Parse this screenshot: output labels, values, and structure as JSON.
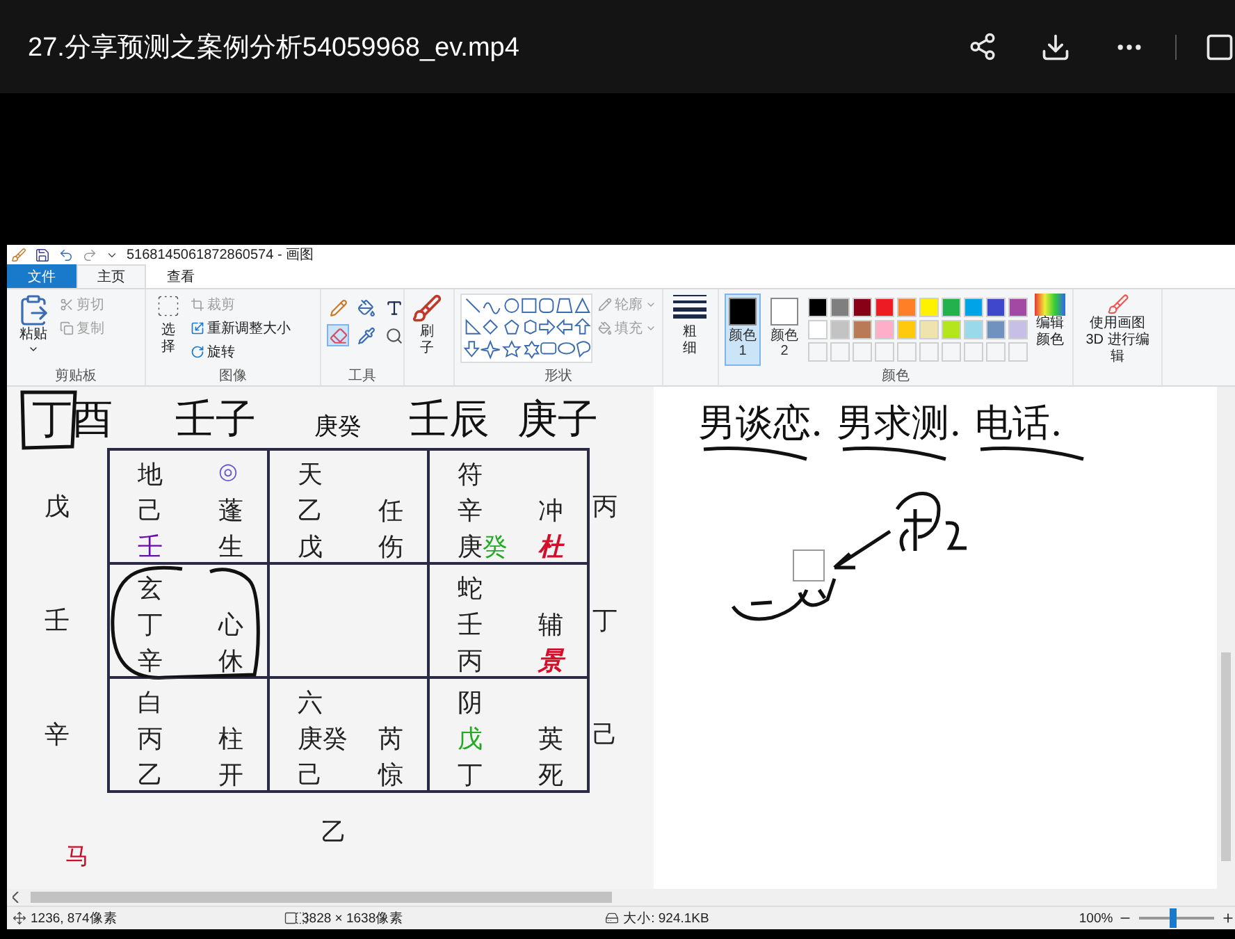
{
  "player": {
    "title": "27.分享预测之案例分析54059968_ev.mp4"
  },
  "paint": {
    "title": "5168145061872860574 - 画图",
    "tabs": [
      {
        "label": "文件",
        "kind": "file",
        "selected": false
      },
      {
        "label": "主页",
        "kind": "tab",
        "selected": true
      },
      {
        "label": "查看",
        "kind": "tab",
        "selected": false
      }
    ],
    "clipboard": {
      "paste": "粘贴",
      "items": [
        {
          "label": "剪切",
          "kind": "cut",
          "disabled": true
        },
        {
          "label": "复制",
          "kind": "copy",
          "disabled": true
        }
      ],
      "group": "剪贴板"
    },
    "image": {
      "select": "选择",
      "items": [
        {
          "label": "裁剪",
          "kind": "crop",
          "disabled": true
        },
        {
          "label": "重新调整大小",
          "kind": "resize",
          "disabled": false
        },
        {
          "label": "旋转",
          "kind": "rotate",
          "disabled": false
        }
      ],
      "group": "图像"
    },
    "tools": {
      "group": "工具"
    },
    "brushes": {
      "label": "刷子"
    },
    "shapes": {
      "group": "形状",
      "items": [
        {
          "label": "轮廓",
          "kind": "outline",
          "disabled": true
        },
        {
          "label": "填充",
          "kind": "fill",
          "disabled": true
        }
      ]
    },
    "size": {
      "label": "粗细"
    },
    "colors": {
      "group": "颜色",
      "slots": [
        {
          "label": "颜色 1",
          "color": "#000000",
          "selected": true
        },
        {
          "label": "颜色 2",
          "color": "#ffffff",
          "selected": false
        }
      ],
      "palette": [
        {
          "color": "#000000"
        },
        {
          "color": "#7f7f7f"
        },
        {
          "color": "#880015"
        },
        {
          "color": "#ed1c24"
        },
        {
          "color": "#ff7f27"
        },
        {
          "color": "#fff200"
        },
        {
          "color": "#22b14c"
        },
        {
          "color": "#00a2e8"
        },
        {
          "color": "#3f48cc"
        },
        {
          "color": "#a349a4"
        },
        {
          "color": "#ffffff"
        },
        {
          "color": "#c3c3c3"
        },
        {
          "color": "#b97a57"
        },
        {
          "color": "#ffaec9"
        },
        {
          "color": "#ffc90e"
        },
        {
          "color": "#efe4b0"
        },
        {
          "color": "#b5e61d"
        },
        {
          "color": "#99d9ea"
        },
        {
          "color": "#7092be"
        },
        {
          "color": "#c8bfe7"
        }
      ],
      "edit": "编辑颜色",
      "paint3d": "使用画图 3D 进行编辑"
    },
    "canvas": {
      "pillars": [
        {
          "text": "丁酉",
          "boxed": true
        },
        {
          "text": "壬子",
          "boxed": false
        },
        {
          "text": "庚癸",
          "kind": "printed",
          "boxed": false
        },
        {
          "text": "壬辰",
          "boxed": false
        },
        {
          "text": "庚子",
          "boxed": false
        }
      ],
      "left": [
        "戊",
        "壬",
        "辛"
      ],
      "right": [
        "丙",
        "丁",
        "己"
      ],
      "bottom": "乙",
      "horse": "马",
      "cells": [
        {
          "god": "地",
          "mark": "◎",
          "circled": false,
          "rows": [
            {
              "left": [
                {
                  "text": "己"
                }
              ],
              "right": {
                "text": "蓬"
              }
            },
            {
              "left": [
                {
                  "text": "壬",
                  "color": "#6a0dad"
                }
              ],
              "right": {
                "text": "生"
              }
            }
          ]
        },
        {
          "god": "天",
          "circled": false,
          "rows": [
            {
              "left": [
                {
                  "text": "乙"
                }
              ],
              "right": {
                "text": "任"
              }
            },
            {
              "left": [
                {
                  "text": "戊"
                }
              ],
              "right": {
                "text": "伤"
              }
            }
          ]
        },
        {
          "god": "符",
          "circled": false,
          "rows": [
            {
              "left": [
                {
                  "text": "辛"
                }
              ],
              "right": {
                "text": "冲"
              }
            },
            {
              "left": [
                {
                  "text": "庚"
                },
                {
                  "text": "癸",
                  "color": "#22aa22"
                }
              ],
              "right": {
                "text": "杜",
                "color": "#d0102a",
                "italic": true
              }
            }
          ]
        },
        {
          "god": "玄",
          "circled": true,
          "rows": [
            {
              "left": [
                {
                  "text": "丁"
                }
              ],
              "right": {
                "text": "心"
              }
            },
            {
              "left": [
                {
                  "text": "辛"
                }
              ],
              "right": {
                "text": "休"
              }
            }
          ]
        },
        {
          "circled": false
        },
        {
          "god": "蛇",
          "circled": false,
          "rows": [
            {
              "left": [
                {
                  "text": "壬"
                }
              ],
              "right": {
                "text": "辅"
              }
            },
            {
              "left": [
                {
                  "text": "丙"
                }
              ],
              "right": {
                "text": "景",
                "color": "#d0102a",
                "italic": true
              }
            }
          ]
        },
        {
          "god": "白",
          "circled": false,
          "rows": [
            {
              "left": [
                {
                  "text": "丙"
                }
              ],
              "right": {
                "text": "柱"
              }
            },
            {
              "left": [
                {
                  "text": "乙"
                }
              ],
              "right": {
                "text": "开"
              }
            }
          ]
        },
        {
          "god": "六",
          "circled": false,
          "rows": [
            {
              "left": [
                {
                  "text": "庚癸"
                }
              ],
              "right": {
                "text": "芮"
              }
            },
            {
              "left": [
                {
                  "text": "己"
                }
              ],
              "right": {
                "text": "惊"
              }
            }
          ]
        },
        {
          "god": "阴",
          "circled": false,
          "rows": [
            {
              "left": [
                {
                  "text": "戊",
                  "color": "#22aa22"
                }
              ],
              "right": {
                "text": "英"
              }
            },
            {
              "left": [
                {
                  "text": "丁"
                }
              ],
              "right": {
                "text": "死"
              }
            }
          ]
        }
      ],
      "notes": [
        {
          "text": "男谈恋.",
          "underlined": true
        },
        {
          "text": "男求测.",
          "underlined": true
        },
        {
          "text": "电话.",
          "underlined": true
        }
      ]
    },
    "status": {
      "cursor": "1236, 874像素",
      "dimensions": "3828 × 1638像素",
      "size": "大小: 924.1KB",
      "zoom": "100%",
      "level": 0.45
    }
  }
}
